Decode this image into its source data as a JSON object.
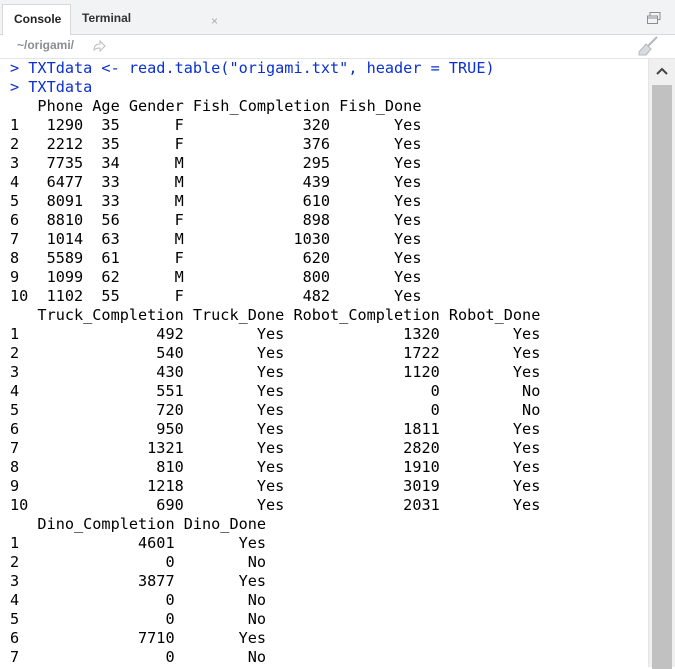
{
  "tabs": [
    {
      "label": "Console"
    },
    {
      "label": "Terminal"
    }
  ],
  "tab_close_glyph": "×",
  "path": "~/origami/",
  "icons": {
    "maximize": "window-icon",
    "path_arrow": "go-to-directory-icon",
    "clear": "broom-icon",
    "scroll_up": "chevron-up-icon"
  },
  "colors": {
    "command": "#0a30d0",
    "output": "#000000",
    "scroll_thumb": "#c1c1c1"
  },
  "console_lines": [
    {
      "text": "> TXTdata <- read.table(\"origami.txt\", header = TRUE)",
      "kind": "cmd"
    },
    {
      "text": "> TXTdata",
      "kind": "cmd"
    },
    {
      "text": "   Phone Age Gender Fish_Completion Fish_Done",
      "kind": "out"
    },
    {
      "text": "1   1290  35      F             320       Yes",
      "kind": "out"
    },
    {
      "text": "2   2212  35      F             376       Yes",
      "kind": "out"
    },
    {
      "text": "3   7735  34      M             295       Yes",
      "kind": "out"
    },
    {
      "text": "4   6477  33      M             439       Yes",
      "kind": "out"
    },
    {
      "text": "5   8091  33      M             610       Yes",
      "kind": "out"
    },
    {
      "text": "6   8810  56      F             898       Yes",
      "kind": "out"
    },
    {
      "text": "7   1014  63      M            1030       Yes",
      "kind": "out"
    },
    {
      "text": "8   5589  61      F             620       Yes",
      "kind": "out"
    },
    {
      "text": "9   1099  62      M             800       Yes",
      "kind": "out"
    },
    {
      "text": "10  1102  55      F             482       Yes",
      "kind": "out"
    },
    {
      "text": "   Truck_Completion Truck_Done Robot_Completion Robot_Done",
      "kind": "out"
    },
    {
      "text": "1               492        Yes             1320        Yes",
      "kind": "out"
    },
    {
      "text": "2               540        Yes             1722        Yes",
      "kind": "out"
    },
    {
      "text": "3               430        Yes             1120        Yes",
      "kind": "out"
    },
    {
      "text": "4               551        Yes                0         No",
      "kind": "out"
    },
    {
      "text": "5               720        Yes                0         No",
      "kind": "out"
    },
    {
      "text": "6               950        Yes             1811        Yes",
      "kind": "out"
    },
    {
      "text": "7              1321        Yes             2820        Yes",
      "kind": "out"
    },
    {
      "text": "8               810        Yes             1910        Yes",
      "kind": "out"
    },
    {
      "text": "9              1218        Yes             3019        Yes",
      "kind": "out"
    },
    {
      "text": "10              690        Yes             2031        Yes",
      "kind": "out"
    },
    {
      "text": "   Dino_Completion Dino_Done",
      "kind": "out"
    },
    {
      "text": "1             4601       Yes",
      "kind": "out"
    },
    {
      "text": "2                0        No",
      "kind": "out"
    },
    {
      "text": "3             3877       Yes",
      "kind": "out"
    },
    {
      "text": "4                0        No",
      "kind": "out"
    },
    {
      "text": "5                0        No",
      "kind": "out"
    },
    {
      "text": "6             7710       Yes",
      "kind": "out"
    },
    {
      "text": "7                0        No",
      "kind": "out"
    }
  ]
}
